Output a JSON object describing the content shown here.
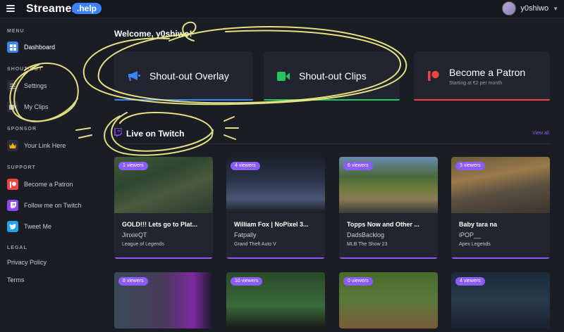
{
  "header": {
    "logo": "Streamer",
    "logo_badge": ".help",
    "username": "y0shiwo"
  },
  "sidebar": {
    "menu_head": "MENU",
    "dashboard": "Dashboard",
    "shoutout_head": "SHOUT-OUT",
    "settings": "Settings",
    "my_clips": "My Clips",
    "sponsor_head": "SPONSOR",
    "your_link": "Your Link Here",
    "support_head": "SUPPORT",
    "become_patron": "Become a Patron",
    "follow_twitch": "Follow me on Twitch",
    "tweet_me": "Tweet Me",
    "legal_head": "LEGAL",
    "privacy": "Privacy Policy",
    "terms": "Terms"
  },
  "main": {
    "welcome": "Welcome, y0shiwo!",
    "cards": {
      "overlay": "Shout-out Overlay",
      "clips": "Shout-out Clips",
      "patron": "Become a Patron",
      "patron_sub": "Starting at €2 per month"
    },
    "live_title": "Live on Twitch",
    "view_all": "View all",
    "streams": [
      {
        "viewers": "1 viewers",
        "title": "GOLD!!! Lets go to Plat...",
        "user": "JinxieQT",
        "game": "League of Legends"
      },
      {
        "viewers": "4 viewers",
        "title": "William Fox | NoPixel 3...",
        "user": "Fatpally",
        "game": "Grand Theft Auto V"
      },
      {
        "viewers": "6 viewers",
        "title": "Topps Now and Other ...",
        "user": "DadsBacklog",
        "game": "MLB The Show 23"
      },
      {
        "viewers": "3 viewers",
        "title": "Baby tara na",
        "user": "iPOP__",
        "game": "Apex Legends"
      },
      {
        "viewers": "8 viewers"
      },
      {
        "viewers": "10 viewers"
      },
      {
        "viewers": "0 viewers"
      },
      {
        "viewers": "4 viewers"
      }
    ]
  },
  "colors": {
    "accent": "#8b5cf6",
    "blue": "#3b82f6",
    "green": "#22c55e",
    "red": "#ef4444",
    "twitch": "#9146ff",
    "twitter": "#1da1f2",
    "scribble": "#f5f08a"
  }
}
